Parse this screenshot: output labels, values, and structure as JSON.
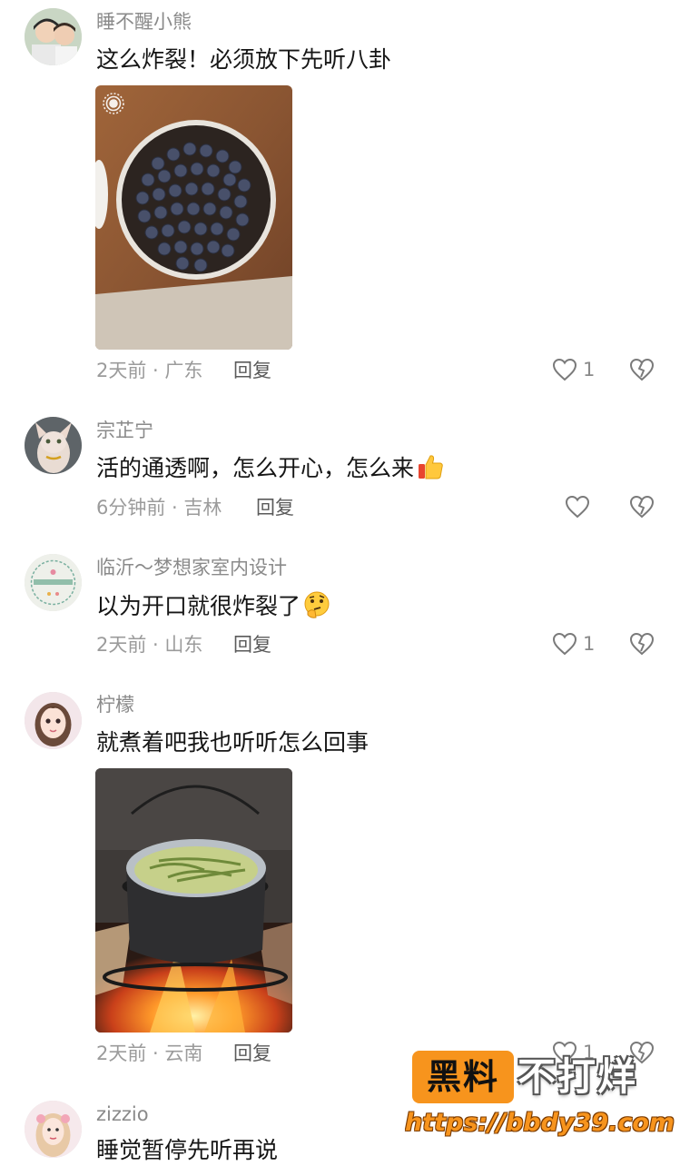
{
  "comments": [
    {
      "username": "睡不醒小熊",
      "text": "这么炸裂！必须放下先听八卦",
      "meta": "2天前 · 广东",
      "reply_label": "回复",
      "like_count": "1",
      "has_image": true,
      "image_description_icon": "blueberry-cake-photo"
    },
    {
      "username": "宗芷宁",
      "text": "活的通透啊，怎么开心，怎么来",
      "emoji": "thumbs-up",
      "meta": "6分钟前 · 吉林",
      "reply_label": "回复",
      "like_count": ""
    },
    {
      "username": "临沂～梦想家室内设计",
      "text": "以为开口就很炸裂了",
      "emoji": "thinking-face",
      "meta": "2天前 · 山东",
      "reply_label": "回复",
      "like_count": "1"
    },
    {
      "username": "柠檬",
      "text": "就煮着吧我也听听怎么回事",
      "meta": "2天前 · 云南",
      "reply_label": "回复",
      "like_count": "1",
      "has_image": true,
      "image_description_icon": "cooking-pot-fire-photo"
    },
    {
      "username": "zizzio",
      "text": "睡觉暂停先听再说"
    }
  ],
  "watermark": {
    "badge": "黑料",
    "title": "不打烊",
    "url": "https://bbdy39.com"
  },
  "colors": {
    "accent": "#f7941d",
    "meta_text": "#9b9b9b",
    "username": "#8a8a8a"
  }
}
